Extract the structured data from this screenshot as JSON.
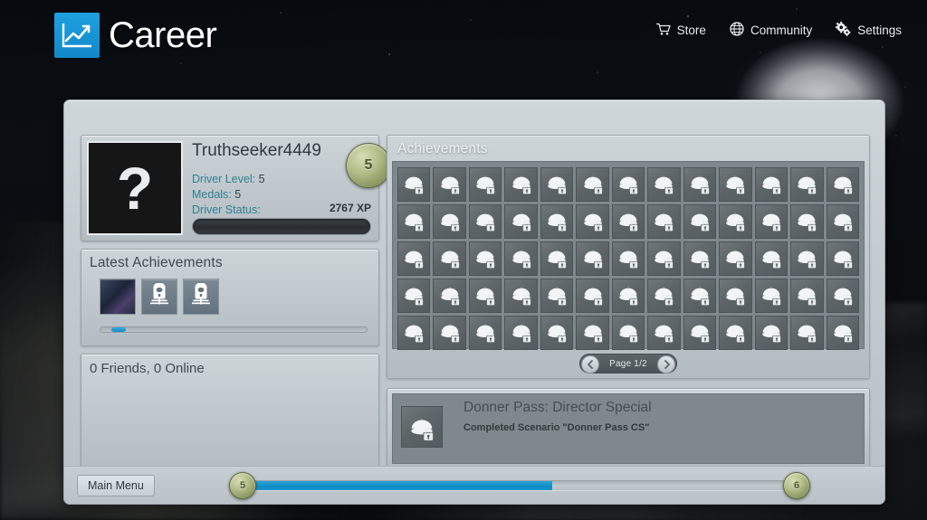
{
  "header": {
    "title": "Career",
    "brand_icon": "line-chart-icon",
    "brand_color": "#1a93d4",
    "nav": [
      {
        "label": "Store",
        "icon": "shopping-cart-icon"
      },
      {
        "label": "Community",
        "icon": "globe-icon"
      },
      {
        "label": "Settings",
        "icon": "gears-icon"
      }
    ]
  },
  "profile": {
    "avatar_placeholder": "?",
    "avatar_icon": "unknown-avatar-icon",
    "username": "Truthseeker4449",
    "level_label": "Driver Level:",
    "level_value": "5",
    "medals_label": "Medals:",
    "medals_value": "5",
    "status_label": "Driver Status:",
    "status_value": "",
    "xp_text": "2767 XP",
    "xp_progress_percent": 0,
    "level_medal": "5",
    "label_color": "#2f7f93"
  },
  "latest": {
    "title": "Latest Achievements",
    "thumbnails": [
      {
        "name": "locomotive-artwork-thumbnail",
        "icon": "locomotive-image"
      },
      {
        "name": "train-front-achievement-thumbnail",
        "icon": "train-front-icon"
      },
      {
        "name": "train-front-achievement-thumbnail",
        "icon": "train-front-icon"
      }
    ],
    "scroll_position_percent": 4
  },
  "friends": {
    "summary": "0 Friends, 0 Online",
    "count": 0,
    "online": 0
  },
  "achievements": {
    "title": "Achievements",
    "columns": 13,
    "rows": 5,
    "total_cells": 65,
    "cell_icon": "locked-achievement-icon",
    "cell_state": "locked",
    "pager": {
      "label": "Page 1/2",
      "current_page": 1,
      "total_pages": 2,
      "prev_icon": "chevron-left-icon",
      "next_icon": "chevron-right-icon"
    }
  },
  "detail": {
    "icon": "locked-achievement-icon",
    "name": "Donner Pass: Director Special",
    "description": "Completed Scenario \"Donner Pass CS\""
  },
  "footer": {
    "main_menu_label": "Main Menu",
    "level_from": "5",
    "level_to": "6",
    "level_progress_percent": 56,
    "progress_color": "#0f8cc6"
  }
}
